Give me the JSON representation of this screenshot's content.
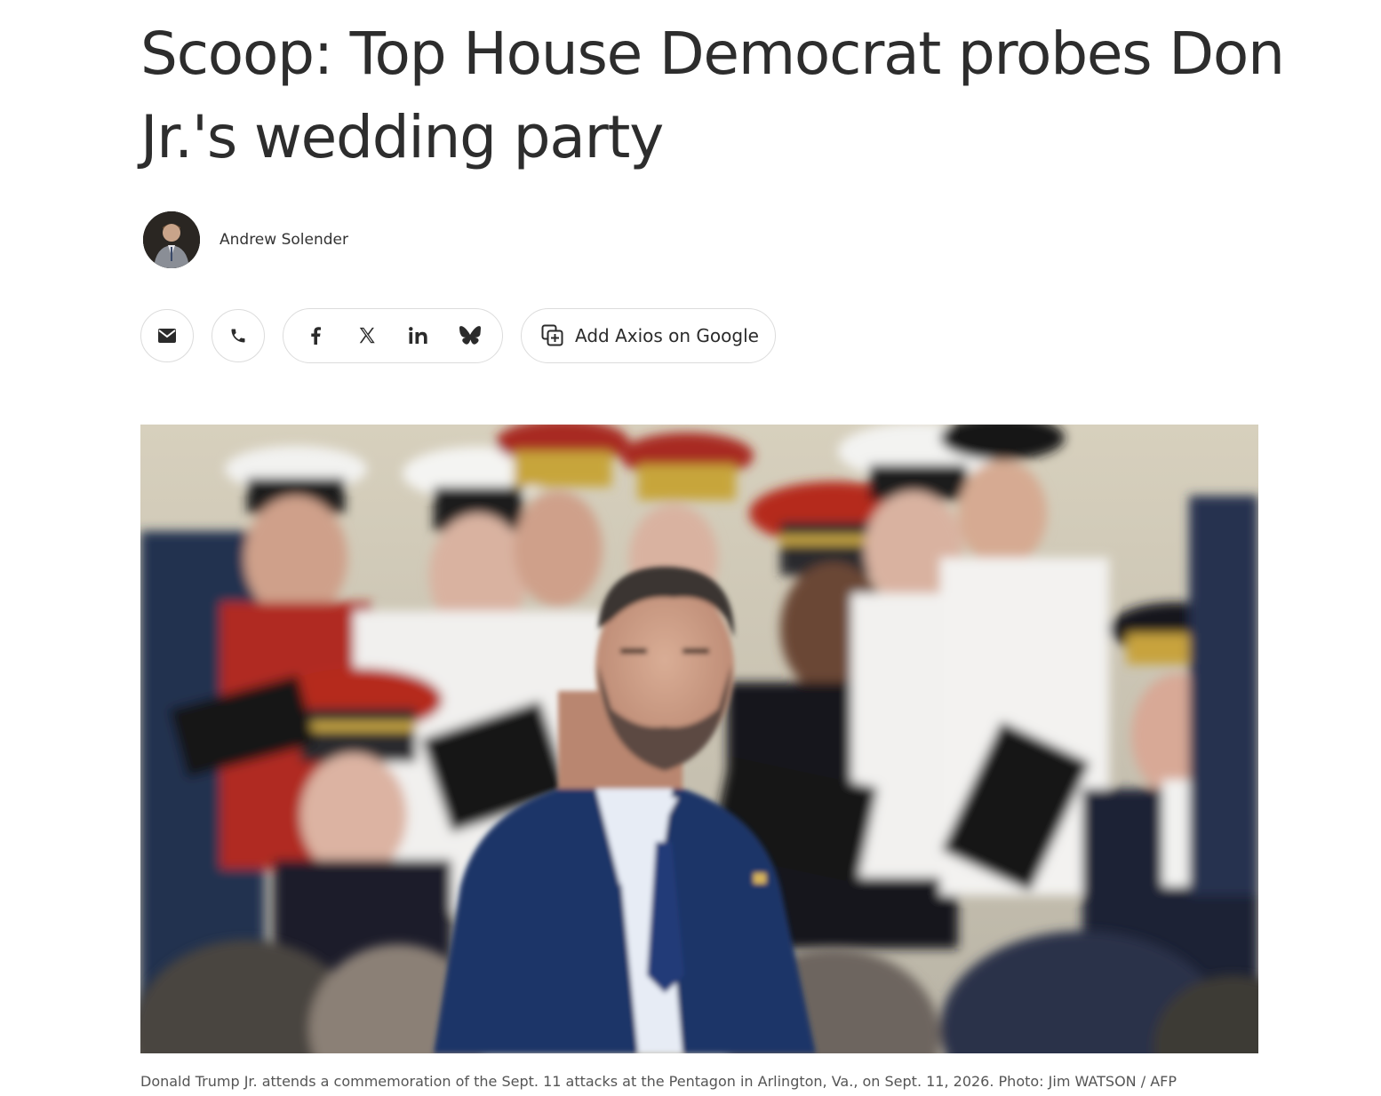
{
  "article": {
    "headline": "Scoop: Top House Democrat probes Don Jr.'s wedding party",
    "author": "Andrew Solender",
    "caption": "Donald Trump Jr. attends a commemoration of the Sept. 11 attacks at the Pentagon in Arlington, Va., on Sept. 11, 2026. Photo: Jim WATSON / AFP"
  },
  "share": {
    "buttons": [
      {
        "name": "email",
        "icon": "envelope-icon"
      },
      {
        "name": "phone",
        "icon": "phone-icon"
      }
    ],
    "social": [
      {
        "name": "facebook",
        "icon": "facebook-icon"
      },
      {
        "name": "x",
        "icon": "x-icon"
      },
      {
        "name": "linkedin",
        "icon": "linkedin-icon"
      },
      {
        "name": "bluesky",
        "icon": "bluesky-icon"
      }
    ],
    "google_label": "Add Axios on Google"
  },
  "colors": {
    "text": "#2d2d2d",
    "border": "#dcdcdc",
    "caption": "#555555"
  }
}
